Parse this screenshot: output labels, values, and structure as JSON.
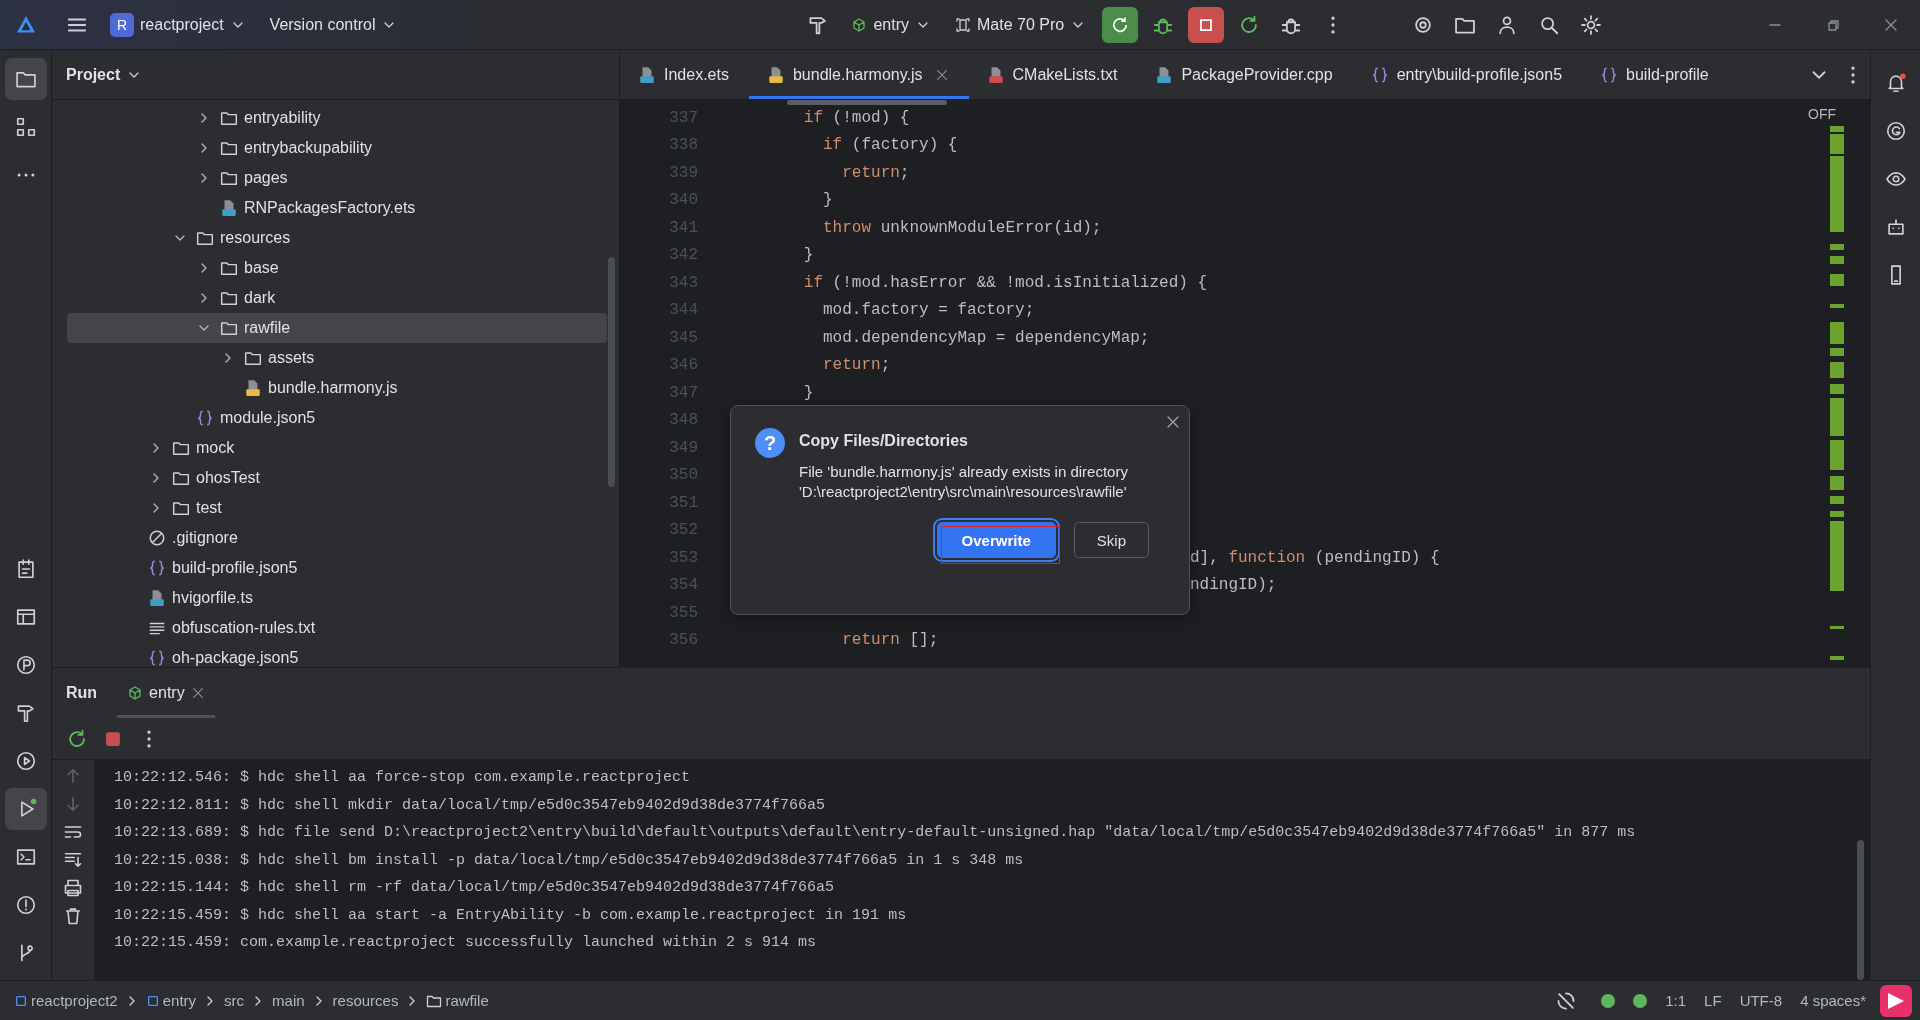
{
  "title_bar": {
    "project_badge": "R",
    "project": "reactproject",
    "vcs": "Version control",
    "run_config": "entry",
    "device": "Mate 70 Pro"
  },
  "left_toolbar": {
    "top": [
      {
        "kind": "project",
        "selected": true
      },
      {
        "kind": "structure",
        "selected": false
      },
      {
        "kind": "more",
        "selected": false
      }
    ],
    "bottom": [
      {
        "kind": "todo",
        "selected": false
      },
      {
        "kind": "layout",
        "selected": false
      },
      {
        "kind": "profiler",
        "selected": false
      },
      {
        "kind": "build",
        "selected": false
      },
      {
        "kind": "services",
        "selected": false
      },
      {
        "kind": "run",
        "selected": true,
        "running": true
      },
      {
        "kind": "terminal",
        "selected": false
      },
      {
        "kind": "problems",
        "selected": false
      },
      {
        "kind": "git",
        "selected": false
      }
    ]
  },
  "project": {
    "title": "Project",
    "tree": [
      {
        "children": [
          {
            "children": [
              {
                "children": [
                  {
                    "label": "entryability",
                    "kind": "folder",
                    "expanded": false,
                    "selected": false
                  },
                  {
                    "label": "entrybackupability",
                    "kind": "folder",
                    "expanded": false,
                    "selected": false
                  },
                  {
                    "label": "pages",
                    "kind": "folder",
                    "expanded": false,
                    "selected": false
                  },
                  {
                    "label": "RNPackagesFactory.ets",
                    "kind": "ets",
                    "selected": false
                  }
                ]
              },
              {
                "label": "resources",
                "kind": "folder",
                "expanded": true,
                "selected": false,
                "children": [
                  {
                    "label": "base",
                    "kind": "folder",
                    "expanded": false,
                    "selected": false
                  },
                  {
                    "label": "dark",
                    "kind": "folder",
                    "expanded": false,
                    "selected": false
                  },
                  {
                    "label": "rawfile",
                    "kind": "folder",
                    "expanded": true,
                    "selected": true,
                    "children": [
                      {
                        "label": "assets",
                        "kind": "folder",
                        "expanded": false,
                        "selected": false
                      },
                      {
                        "label": "bundle.harmony.js",
                        "kind": "js",
                        "selected": false
                      }
                    ]
                  }
                ]
              },
              {
                "label": "module.json5",
                "kind": "json",
                "selected": false
              }
            ]
          },
          {
            "label": "mock",
            "kind": "folder",
            "expanded": false,
            "selected": false
          },
          {
            "label": "ohosTest",
            "kind": "folder",
            "expanded": false,
            "selected": false
          },
          {
            "label": "test",
            "kind": "folder",
            "expanded": false,
            "selected": false
          }
        ]
      },
      {
        "label": ".gitignore",
        "kind": "ignore",
        "selected": false
      },
      {
        "label": "build-profile.json5",
        "kind": "json",
        "selected": false
      },
      {
        "label": "hvigorfile.ts",
        "kind": "ts",
        "selected": false
      },
      {
        "label": "obfuscation-rules.txt",
        "kind": "text",
        "selected": false
      },
      {
        "label": "oh-package.json5",
        "kind": "json",
        "selected": false
      }
    ]
  },
  "editor": {
    "tabs": [
      {
        "label": "Index.ets",
        "kind": "ets",
        "selected": false
      },
      {
        "label": "bundle.harmony.js",
        "kind": "js",
        "selected": true
      },
      {
        "label": "CMakeLists.txt",
        "kind": "cmake",
        "selected": false
      },
      {
        "label": "PackageProvider.cpp",
        "kind": "cpp",
        "selected": false
      },
      {
        "label": "entry\\build-profile.json5",
        "kind": "json",
        "selected": false
      },
      {
        "label": "build-profile",
        "kind": "json",
        "selected": false
      }
    ],
    "inspection": "OFF",
    "lines": [
      {
        "number": "337",
        "segments": [
          {
            "text": "        if",
            "kind": "keyword"
          },
          {
            "text": " (!mod) {",
            "kind": "plain"
          }
        ]
      },
      {
        "number": "338",
        "segments": [
          {
            "text": "          if",
            "kind": "keyword"
          },
          {
            "text": " (factory) {",
            "kind": "plain"
          }
        ]
      },
      {
        "number": "339",
        "segments": [
          {
            "text": "            return",
            "kind": "keyword"
          },
          {
            "text": ";",
            "kind": "plain"
          }
        ]
      },
      {
        "number": "340",
        "segments": [
          {
            "text": "          }",
            "kind": "plain"
          }
        ]
      },
      {
        "number": "341",
        "segments": [
          {
            "text": "          throw",
            "kind": "keyword"
          },
          {
            "text": " unknownModuleError(id);",
            "kind": "plain"
          }
        ]
      },
      {
        "number": "342",
        "segments": [
          {
            "text": "        }",
            "kind": "plain"
          }
        ]
      },
      {
        "number": "343",
        "segments": [
          {
            "text": "        if",
            "kind": "keyword"
          },
          {
            "text": " (!mod.hasError && !mod.isInitialized) {",
            "kind": "plain"
          }
        ]
      },
      {
        "number": "344",
        "segments": [
          {
            "text": "          mod.factory = factory;",
            "kind": "plain"
          }
        ]
      },
      {
        "number": "345",
        "segments": [
          {
            "text": "          mod.dependencyMap = dependencyMap;",
            "kind": "plain"
          }
        ]
      },
      {
        "number": "346",
        "segments": [
          {
            "text": "          return",
            "kind": "keyword"
          },
          {
            "text": ";",
            "kind": "plain"
          }
        ]
      },
      {
        "number": "347",
        "segments": [
          {
            "text": "        }",
            "kind": "plain"
          }
        ]
      },
      {
        "number": "348"
      },
      {
        "number": "349"
      },
      {
        "number": "350"
      },
      {
        "number": "351"
      },
      {
        "number": "352"
      },
      {
        "number": "353",
        "occluded": true,
        "segments": [
          {
            "text": "d], ",
            "kind": "plain"
          },
          {
            "text": "function",
            "kind": "keyword"
          },
          {
            "text": " (pendingID) {",
            "kind": "plain"
          }
        ]
      },
      {
        "number": "354",
        "occluded": true,
        "segments": [
          {
            "text": "ndingID);",
            "kind": "plain"
          }
        ]
      },
      {
        "number": "355"
      },
      {
        "number": "356",
        "segments": [
          {
            "text": "            return",
            "kind": "keyword"
          },
          {
            "text": " [];",
            "kind": "plain"
          }
        ]
      }
    ]
  },
  "dialog": {
    "icon": "?",
    "title": "Copy Files/Directories",
    "message": "File 'bundle.harmony.js' already exists in directory 'D:\\reactproject2\\entry\\src\\main\\resources\\rawfile'",
    "buttons": [
      {
        "label": "Overwrite",
        "primary": true,
        "focused": true,
        "annotated": true
      },
      {
        "label": "Skip",
        "primary": false,
        "focused": false,
        "annotated": false
      }
    ]
  },
  "right_toolbar": [
    {
      "kind": "notifications",
      "badge": true
    },
    {
      "kind": "g-circle",
      "badge": false
    },
    {
      "kind": "preview",
      "badge": false
    },
    {
      "kind": "robot",
      "badge": false
    },
    {
      "kind": "device",
      "badge": false
    }
  ],
  "run_panel": {
    "title": "Run",
    "tabs": [
      {
        "label": "entry",
        "selected": true
      }
    ],
    "log": [
      "10:22:12.546: $ hdc shell aa force-stop com.example.reactproject",
      "10:22:12.811: $ hdc shell mkdir data/local/tmp/e5d0c3547eb9402d9d38de3774f766a5",
      "10:22:13.689: $ hdc file send D:\\reactproject2\\entry\\build\\default\\outputs\\default\\entry-default-unsigned.hap \"data/local/tmp/e5d0c3547eb9402d9d38de3774f766a5\" in 877 ms",
      "10:22:15.038: $ hdc shell bm install -p data/local/tmp/e5d0c3547eb9402d9d38de3774f766a5 in 1 s 348 ms",
      "10:22:15.144: $ hdc shell rm -rf data/local/tmp/e5d0c3547eb9402d9d38de3774f766a5",
      "10:22:15.459: $ hdc shell aa start -a EntryAbility -b com.example.reactproject in 191 ms",
      "10:22:15.459: com.example.reactproject successfully launched within 2 s 914 ms"
    ]
  },
  "status_bar": {
    "breadcrumbs": [
      {
        "label": "reactproject2",
        "kind": "module"
      },
      {
        "label": "entry",
        "kind": "module"
      },
      {
        "label": "src",
        "kind": "plain"
      },
      {
        "label": "main",
        "kind": "plain"
      },
      {
        "label": "resources",
        "kind": "plain"
      },
      {
        "label": "rawfile",
        "kind": "folder"
      }
    ],
    "position": "1:1",
    "line_separator": "LF",
    "encoding": "UTF-8",
    "indent": "4 spaces*"
  }
}
